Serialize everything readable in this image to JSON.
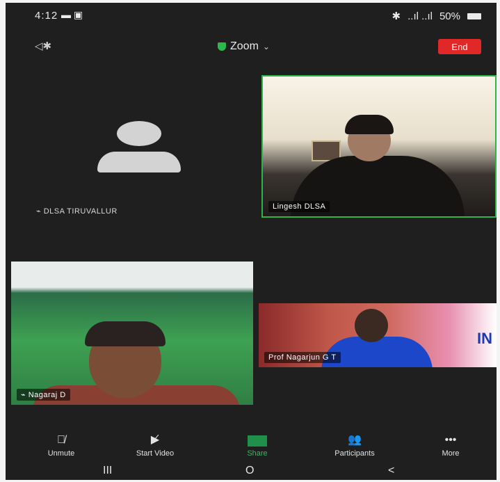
{
  "status_bar": {
    "time": "4:12",
    "notification_glyphs": "▬ ▣",
    "bluetooth_glyph": "✱",
    "signal_text": "..ıl ..ıl",
    "battery": "50%"
  },
  "meeting": {
    "speaker_icon": "speaker-bluetooth-icon",
    "title": "Zoom",
    "end_label": "End",
    "accent_green": "#2fb34a",
    "end_red": "#e02828"
  },
  "participants": [
    {
      "name": "DLSA TIRUVALLUR",
      "video": false
    },
    {
      "name": "Lingesh DLSA",
      "video": true,
      "active_speaker": true
    },
    {
      "name": "Nagaraj D",
      "video": true
    },
    {
      "name": "Prof Nagarjun G T",
      "video": true
    }
  ],
  "tile_extra": {
    "banner_letters": "IN"
  },
  "toolbar": {
    "unmute": "Unmute",
    "start_video": "Start Video",
    "share": "Share",
    "participants": "Participants",
    "more": "More"
  },
  "navbar": {
    "recent": "III",
    "home": "O",
    "back": "<"
  }
}
